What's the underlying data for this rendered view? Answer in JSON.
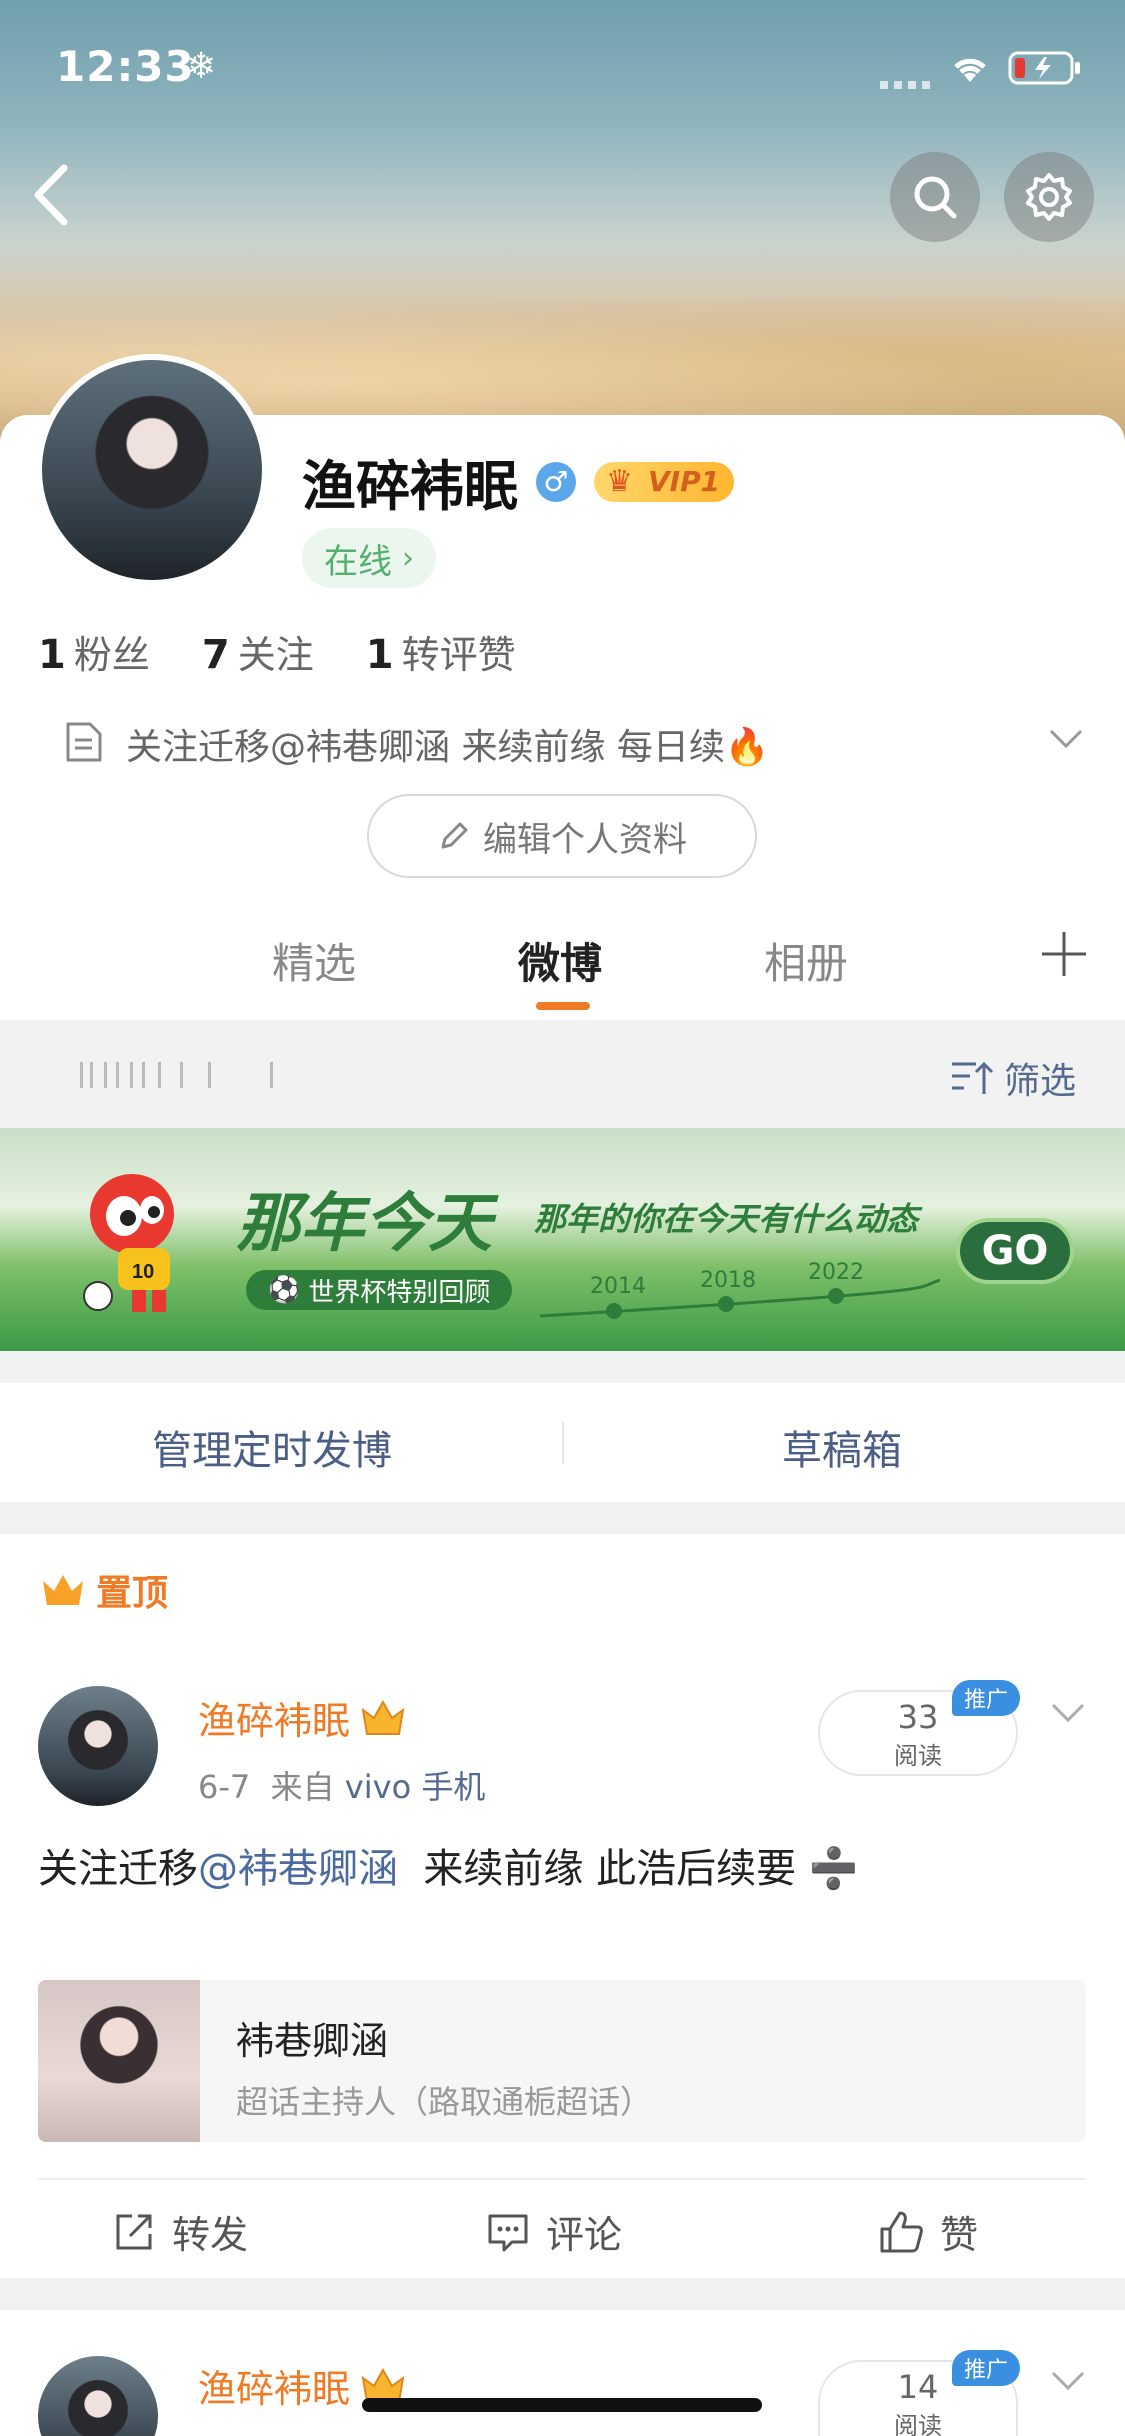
{
  "status_bar": {
    "time": "12:33",
    "weather_icon": "snowflake-icon"
  },
  "profile": {
    "name": "渔碎袆眠",
    "vip_label": "VIP1",
    "online_label": "在线",
    "stats": [
      {
        "value": "1",
        "label": "粉丝"
      },
      {
        "value": "7",
        "label": "关注"
      },
      {
        "value": "1",
        "label": "转评赞"
      }
    ],
    "bio": "关注迁移@袆巷卿涵  来续前缘 每日续🔥",
    "edit_label": "编辑个人资料"
  },
  "tabs": [
    {
      "label": "精选"
    },
    {
      "label": "微博"
    },
    {
      "label": "相册"
    }
  ],
  "feed_bar": {
    "filter_label": "筛选"
  },
  "promo": {
    "title": "那年今天",
    "subtitle": "那年的你在今天有什么动态",
    "tag": "世界杯特别回顾",
    "years": [
      "2014",
      "2018",
      "2022"
    ],
    "go_label": "GO"
  },
  "actions": {
    "scheduled": "管理定时发博",
    "drafts": "草稿箱"
  },
  "pinned_label": "置顶",
  "posts": [
    {
      "author": "渔碎袆眠",
      "date": "6-7",
      "source_prefix": "来自",
      "source": "vivo 手机",
      "reads": "33",
      "reads_label": "阅读",
      "badge": "推广",
      "text_before": "关注迁移",
      "mention": "@袆巷卿涵",
      "text_after": "  来续前缘 此浩后续要 ➗",
      "card_title": "袆巷卿涵",
      "card_sub": "超话主持人（路取通栀超话）",
      "repost": "转发",
      "comment": "评论",
      "like": "赞"
    },
    {
      "author": "渔碎袆眠",
      "reads": "14",
      "reads_label": "阅读",
      "badge": "推广"
    }
  ],
  "colors": {
    "accent": "#f07b26",
    "link": "#4b6aa0",
    "green": "#2f7d3b"
  }
}
